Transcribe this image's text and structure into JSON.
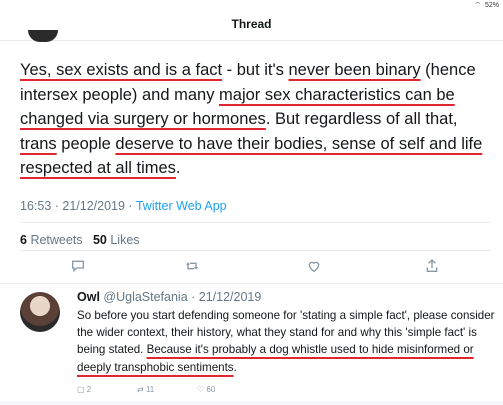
{
  "status": {
    "battery": "52%"
  },
  "header": {
    "title": "Thread"
  },
  "tweet": {
    "text_parts": [
      {
        "t": "Yes, sex exists and is a fact",
        "u": true
      },
      {
        "t": " -  but it's ",
        "u": false
      },
      {
        "t": "never been binary",
        "u": true
      },
      {
        "t": " (hence intersex people) and many ",
        "u": false
      },
      {
        "t": "major sex characteristics can be changed via surgery or hormones",
        "u": true
      },
      {
        "t": ". But regardless of all that, ",
        "u": false
      },
      {
        "t": "trans",
        "u": true
      },
      {
        "t": " people ",
        "u": false
      },
      {
        "t": "deserve to have their bodies, sense of self and life respected at all times",
        "u": true
      },
      {
        "t": ".",
        "u": false
      }
    ],
    "time": "16:53 · 21/12/2019 · ",
    "source": "Twitter Web App",
    "retweets_count": "6",
    "retweets_label": "Retweets",
    "likes_count": "50",
    "likes_label": "Likes"
  },
  "actions": {
    "reply_icon": "comment-icon",
    "retweet_icon": "retweet-icon",
    "like_icon": "heart-icon",
    "share_icon": "share-icon"
  },
  "reply": {
    "name": "Owl",
    "handle_date": " @UglaStefania · 21/12/2019",
    "text_parts": [
      {
        "t": "So before you start defending someone for 'stating a simple fact', please consider the wider context, their history, what they stand for and why this 'simple fact' is being stated. ",
        "u": false
      },
      {
        "t": "Because it's probably a dog whistle used to hide misinformed or deeply transphobic sentiments",
        "u": true
      },
      {
        "t": ".",
        "u": false
      }
    ],
    "reply_count": "2",
    "retweet_count": "11",
    "like_count": "60"
  }
}
